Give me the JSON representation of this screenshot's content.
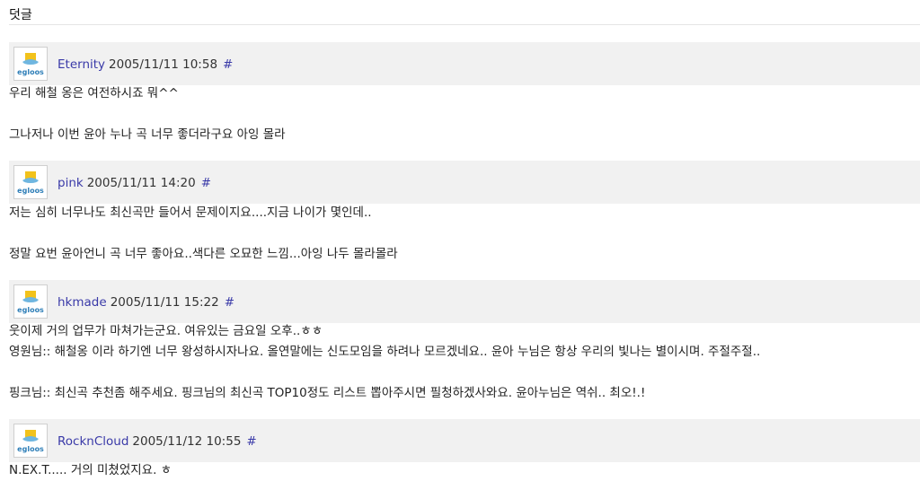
{
  "section": {
    "title": "덧글"
  },
  "avatar_text": "egloos",
  "comments": [
    {
      "author": "Eternity",
      "date": "2005/11/11 10:58",
      "permalink": "#",
      "lines": [
        "우리 해철 옹은 여전하시죠 뭐^^",
        "그나저나 이번 윤아 누나 곡 너무 좋더라구요 아잉 몰라"
      ]
    },
    {
      "author": "pink",
      "date": "2005/11/11 14:20",
      "permalink": "#",
      "lines": [
        "저는 심히 너무나도 최신곡만 들어서 문제이지요....지금 나이가 몇인데..",
        "정말 요번 윤아언니 곡 너무 좋아요..색다른 오묘한 느낌...아잉 나두 몰라몰라"
      ]
    },
    {
      "author": "hkmade",
      "date": "2005/11/11 15:22",
      "permalink": "#",
      "lines": [
        "웃이제 거의 업무가 마쳐가는군요. 여유있는 금요일 오후..ㅎㅎ",
        "영원님:: 해철옹 이라 하기엔 너무 왕성하시자나요. 올연말에는 신도모임을 하려나 모르겠네요.. 윤아 누님은 항상 우리의 빛나는 별이시며. 주절주절..",
        "핑크님:: 최신곡 추천좀 해주세요. 핑크님의 최신곡 TOP10정도 리스트 뽑아주시면 필청하겠사와요. 윤아누님은 역쉬.. 최오!.!"
      ]
    },
    {
      "author": "RocknCloud",
      "date": "2005/11/12 10:55",
      "permalink": "#",
      "lines": [
        "N.EX.T..... 거의 미쳤었지요. ㅎ"
      ]
    }
  ]
}
